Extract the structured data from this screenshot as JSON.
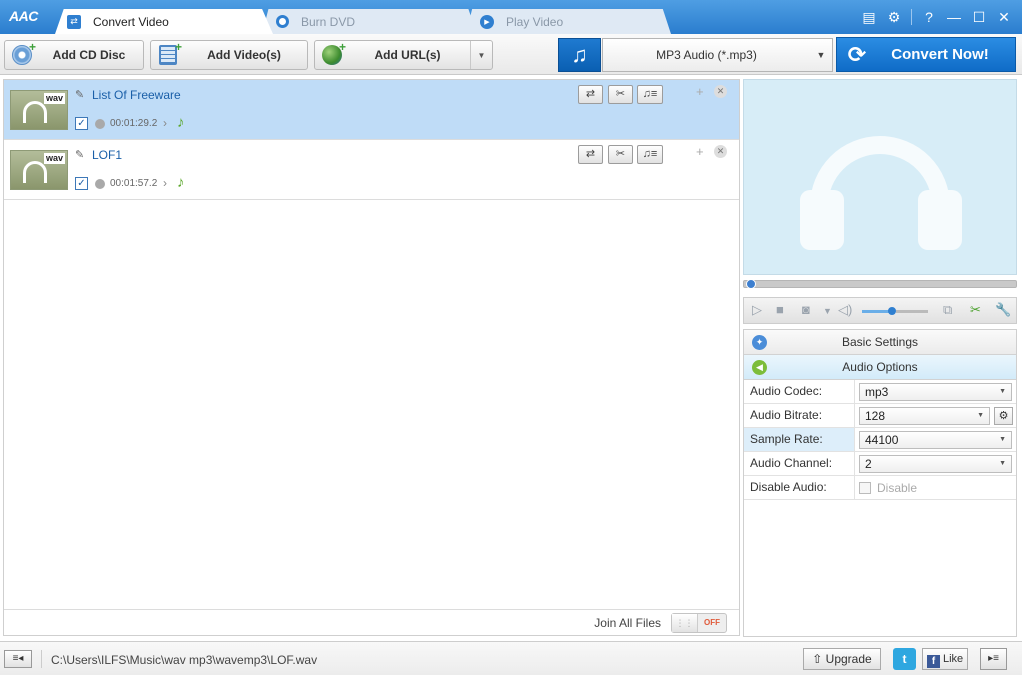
{
  "app": {
    "logo": "AAC"
  },
  "tabs": [
    {
      "label": "Convert Video",
      "active": true
    },
    {
      "label": "Burn DVD",
      "active": false
    },
    {
      "label": "Play Video",
      "active": false
    }
  ],
  "window_controls": {
    "register": "▤",
    "settings": "⚙",
    "help": "?",
    "minimize": "—",
    "maximize": "☐",
    "close": "✕"
  },
  "toolbar": {
    "add_cd_label": "Add CD Disc",
    "add_video_label": "Add Video(s)",
    "add_url_label": "Add URL(s)",
    "format_value": "MP3 Audio (*.mp3)",
    "convert_label": "Convert Now!"
  },
  "files": [
    {
      "thumb_label": "wav",
      "name": "List Of Freeware",
      "duration": "00:01:29.2",
      "checked": true,
      "selected": true
    },
    {
      "thumb_label": "wav",
      "name": "LOF1",
      "duration": "00:01:57.2",
      "checked": true,
      "selected": false
    }
  ],
  "join": {
    "label": "Join All Files",
    "state": "OFF"
  },
  "player": {
    "volume_fraction": 0.45,
    "position_fraction": 0.0
  },
  "settings": {
    "basic_title": "Basic Settings",
    "audio_title": "Audio Options",
    "rows": [
      {
        "label": "Audio Codec:",
        "value": "mp3"
      },
      {
        "label": "Audio Bitrate:",
        "value": "128"
      },
      {
        "label": "Sample Rate:",
        "value": "44100"
      },
      {
        "label": "Audio Channel:",
        "value": "2"
      },
      {
        "label": "Disable Audio:",
        "value": "Disable"
      }
    ]
  },
  "status": {
    "path": "C:\\Users\\ILFS\\Music\\wav mp3\\wavemp3\\LOF.wav",
    "upgrade_label": "Upgrade",
    "like_label": "Like",
    "twitter_label": "t"
  },
  "colors": {
    "accent": "#2a7dce",
    "selection": "#bfdcf7",
    "convert": "#1a7dd6"
  }
}
